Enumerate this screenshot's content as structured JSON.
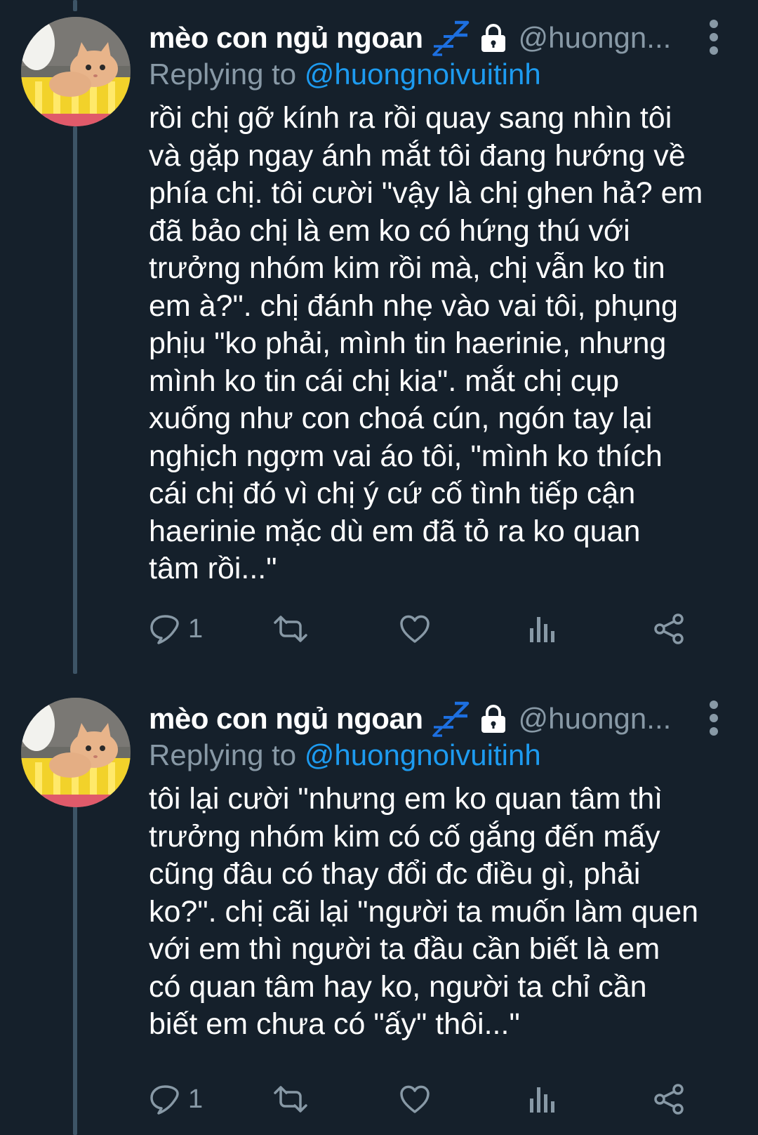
{
  "tweets": [
    {
      "display_name": "mèo con ngủ ngoan",
      "handle": "@huongn...",
      "replying_label": "Replying to",
      "replying_handle": "@huongnoivuitinh",
      "lines": [
        "rồi chị gỡ kính ra rồi quay sang nhìn tôi",
        "và gặp ngay ánh mắt tôi đang hướng về",
        "phía chị. tôi cười \"vậy là chị ghen hả? em",
        "đã bảo chị là em ko có hứng thú với",
        "trưởng nhóm kim rồi mà, chị vẫn ko tin",
        "em à?\". chị đánh nhẹ vào vai tôi, phụng",
        "phịu \"ko phải, mình tin haerinie, nhưng",
        "mình ko tin cái chị kia\". mắt chị cụp",
        "xuống như con choá cún, ngón tay lại",
        "nghịch ngợm vai áo tôi, \"mình ko thích",
        "cái chị đó vì chị ý cứ cố tình tiếp cận",
        "haerinie mặc dù em đã tỏ ra ko quan",
        "tâm rồi...\""
      ],
      "reply_count": "1"
    },
    {
      "display_name": "mèo con ngủ ngoan",
      "handle": "@huongn...",
      "replying_label": "Replying to",
      "replying_handle": "@huongnoivuitinh",
      "lines": [
        "tôi lại cười \"nhưng em ko quan tâm thì",
        "trưởng nhóm kim có cố gắng đến mấy",
        "cũng đâu có thay đổi đc điều gì, phải",
        "ko?\". chị cãi lại \"người ta muốn làm quen",
        "với em thì người ta đầu cần biết là em",
        "có quan tâm hay ko, người ta chỉ cần",
        "biết em chưa có \"ấy\" thôi...\""
      ],
      "reply_count": "1"
    }
  ],
  "icons": {
    "status_emoji": "zzz-icon",
    "protected": "lock-icon",
    "more": "more-vertical-icon",
    "reply": "reply-icon",
    "retweet": "retweet-icon",
    "like": "heart-icon",
    "analytics": "analytics-icon",
    "share": "share-icon"
  },
  "colors": {
    "background": "#15202b",
    "text": "#ffffff",
    "secondary": "#8899a6",
    "link": "#1d9bf0",
    "thread_line": "#3d5466",
    "zzz": "#1d6fe0"
  }
}
